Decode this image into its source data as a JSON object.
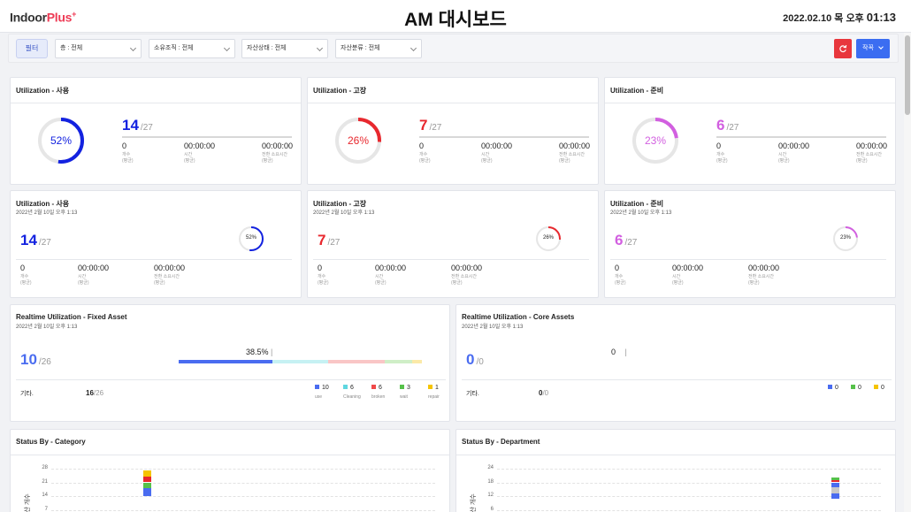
{
  "header": {
    "logo_main": "Indoor",
    "logo_accent": "Plus",
    "logo_sup": "+",
    "title": "AM 대시보드",
    "date": "2022.02.10 목 오후",
    "time": "01:13"
  },
  "filters": {
    "filter_button": "필터",
    "floor": "층 : 전체",
    "org": "소유조직 : 전체",
    "asset_state": "자산상태 : 전체",
    "asset_class": "자산분류 : 전체",
    "collapse_button": "작꼭"
  },
  "utilization_cards": [
    {
      "title": "Utilization - 사용",
      "percent_label": "52%",
      "percent": 52,
      "color": "#1322e0",
      "count": "14",
      "total": "/27",
      "v1": "0",
      "l1a": "개수",
      "l1b": "(평균)",
      "v2": "00:00:00",
      "l2a": "시간",
      "l2b": "(평균)",
      "v3": "00:00:00",
      "l3a": "전환 소요시간",
      "l3b": "(평균)"
    },
    {
      "title": "Utilization - 고장",
      "percent_label": "26%",
      "percent": 26,
      "color": "#e8282e",
      "count": "7",
      "total": "/27",
      "v1": "0",
      "l1a": "개수",
      "l1b": "(평균)",
      "v2": "00:00:00",
      "l2a": "시간",
      "l2b": "(평균)",
      "v3": "00:00:00",
      "l3a": "전환 소요시간",
      "l3b": "(평균)"
    },
    {
      "title": "Utilization - 준비",
      "percent_label": "23%",
      "percent": 23,
      "color": "#d25fe0",
      "count": "6",
      "total": "/27",
      "v1": "0",
      "l1a": "개수",
      "l1b": "(평균)",
      "v2": "00:00:00",
      "l2a": "시간",
      "l2b": "(평균)",
      "v3": "00:00:00",
      "l3a": "전환 소요시간",
      "l3b": "(평균)"
    }
  ],
  "utilization_cards_2": [
    {
      "title": "Utilization - 사용",
      "subtitle": "2022년 2월 10일 오후 1:13",
      "percent_label": "52%",
      "percent": 52,
      "color": "#1322e0",
      "count": "14",
      "total": "/27",
      "v1": "0",
      "l1a": "개수",
      "l1b": "(평균)",
      "v2": "00:00:00",
      "l2a": "시간",
      "l2b": "(평균)",
      "v3": "00:00:00",
      "l3a": "전환 소요시간",
      "l3b": "(평균)"
    },
    {
      "title": "Utilization - 고장",
      "subtitle": "2022년 2월 10일 오후 1:13",
      "percent_label": "26%",
      "percent": 26,
      "color": "#e8282e",
      "count": "7",
      "total": "/27",
      "v1": "0",
      "l1a": "개수",
      "l1b": "(평균)",
      "v2": "00:00:00",
      "l2a": "시간",
      "l2b": "(평균)",
      "v3": "00:00:00",
      "l3a": "전환 소요시간",
      "l3b": "(평균)"
    },
    {
      "title": "Utilization - 준비",
      "subtitle": "2022년 2월 10일 오후 1:13",
      "percent_label": "23%",
      "percent": 23,
      "color": "#d25fe0",
      "count": "6",
      "total": "/27",
      "v1": "0",
      "l1a": "개수",
      "l1b": "(평균)",
      "v2": "00:00:00",
      "l2a": "시간",
      "l2b": "(평균)",
      "v3": "00:00:00",
      "l3a": "전환 소요시간",
      "l3b": "(평균)"
    }
  ],
  "realtime_fixed": {
    "title": "Realtime Utilization - Fixed Asset",
    "subtitle": "2022년 2월 10일 오후 1:13",
    "count": "10",
    "total": "/26",
    "percent_label": "38.5%",
    "percent": 38.5,
    "other_label": "기타.",
    "other_count": "16",
    "other_total": "/26",
    "legend": [
      {
        "value": "10",
        "name": "use",
        "color": "#4a6cf0"
      },
      {
        "value": "6",
        "name": "Cleaning",
        "color": "#5fd7e0"
      },
      {
        "value": "6",
        "name": "broken",
        "color": "#f04a4a"
      },
      {
        "value": "3",
        "name": "wait",
        "color": "#56c14a"
      },
      {
        "value": "1",
        "name": "repair",
        "color": "#f5c400"
      }
    ],
    "segments": [
      {
        "value": 10,
        "color": "#4a6cf0"
      },
      {
        "value": 6,
        "color": "#c6f1f3"
      },
      {
        "value": 6,
        "color": "#f9c6c6"
      },
      {
        "value": 3,
        "color": "#cfeec7"
      },
      {
        "value": 1,
        "color": "#fbe9a8"
      }
    ]
  },
  "realtime_core": {
    "title": "Realtime Utilization - Core Assets",
    "subtitle": "2022년 2월 10일 오후 1:13",
    "count": "0",
    "total": "/0",
    "percent_label": "0",
    "other_label": "기타.",
    "other_count": "0",
    "other_total": "/0",
    "legend": [
      {
        "value": "0",
        "color": "#4a6cf0"
      },
      {
        "value": "0",
        "color": "#56c14a"
      },
      {
        "value": "0",
        "color": "#f5c400"
      }
    ]
  },
  "status_category": {
    "title": "Status By - Category",
    "y_title": "자산 개수",
    "y_ticks": [
      "28",
      "21",
      "14",
      "7"
    ],
    "stack": [
      {
        "value": 3,
        "color": "#f5c400"
      },
      {
        "value": 3,
        "color": "#e8282e"
      },
      {
        "value": 3,
        "color": "#56c14a"
      },
      {
        "value": 4,
        "color": "#4a6cf0"
      }
    ]
  },
  "status_department": {
    "title": "Status By - Department",
    "y_title": "자산 개수",
    "y_ticks": [
      "24",
      "18",
      "12",
      "6"
    ],
    "stack": [
      {
        "value": 1,
        "color": "#56c14a"
      },
      {
        "value": 1,
        "color": "#e8282e"
      },
      {
        "value": 2,
        "color": "#4a6cf0"
      },
      {
        "value": 3,
        "color": "#c8c8c8"
      },
      {
        "value": 2,
        "color": "#4a6cf0"
      }
    ]
  }
}
